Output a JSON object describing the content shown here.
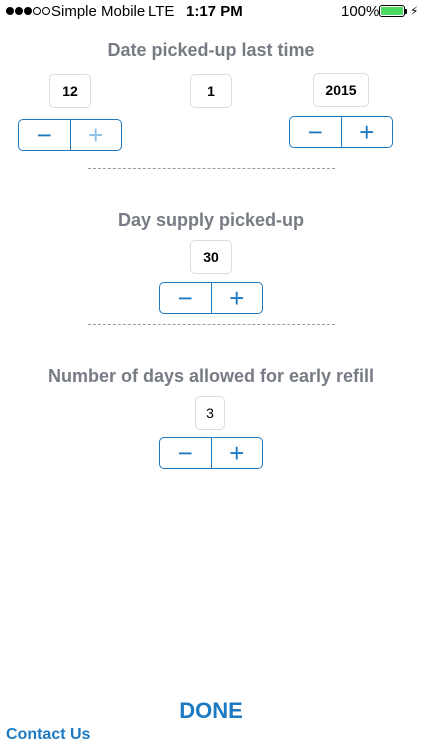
{
  "status_bar": {
    "carrier": "Simple Mobile",
    "network": "LTE",
    "time": "1:17 PM",
    "battery": "100%",
    "battery_level": 1.0,
    "signal_bars_filled": 3,
    "signal_bars_total": 5
  },
  "date_section": {
    "label": "Date picked-up last time",
    "month": "12",
    "day": "1",
    "year": "2015"
  },
  "supply_section": {
    "label": "Day supply picked-up",
    "value": "30"
  },
  "early_refill_section": {
    "label": "Number of days allowed for early refill",
    "value": "3"
  },
  "stepper": {
    "minus_symbol": "−",
    "plus_symbol": "+"
  },
  "actions": {
    "done_label": "DONE",
    "contact_label": "Contact Us"
  },
  "colors": {
    "accent": "#1d7ac2",
    "label_gray": "#777b84",
    "battery_green": "#4cd964"
  }
}
